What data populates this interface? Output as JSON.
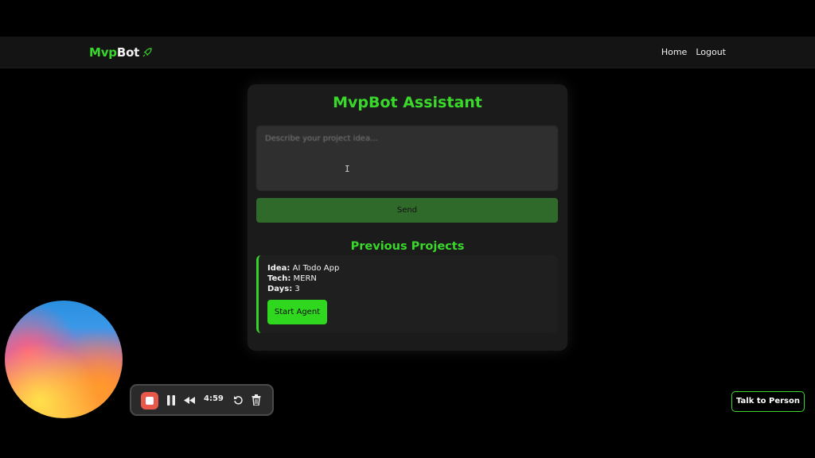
{
  "navbar": {
    "brand_prefix": "Mvp",
    "brand_suffix": "Bot",
    "links": [
      "Home",
      "Logout"
    ]
  },
  "assistant": {
    "title": "MvpBot Assistant",
    "input_placeholder": "Describe your project idea...",
    "send_label": "Send"
  },
  "projects": {
    "title": "Previous Projects",
    "items": [
      {
        "idea_label": "Idea:",
        "idea": "AI Todo App",
        "tech_label": "Tech:",
        "tech": "MERN",
        "days_label": "Days:",
        "days": "3",
        "button_label": "Start Agent"
      }
    ]
  },
  "recorder": {
    "time": "4:59"
  },
  "talk_button": "Talk to Person",
  "colors": {
    "accent": "#39d82b",
    "background": "#000000",
    "card": "#1b1b1b"
  }
}
